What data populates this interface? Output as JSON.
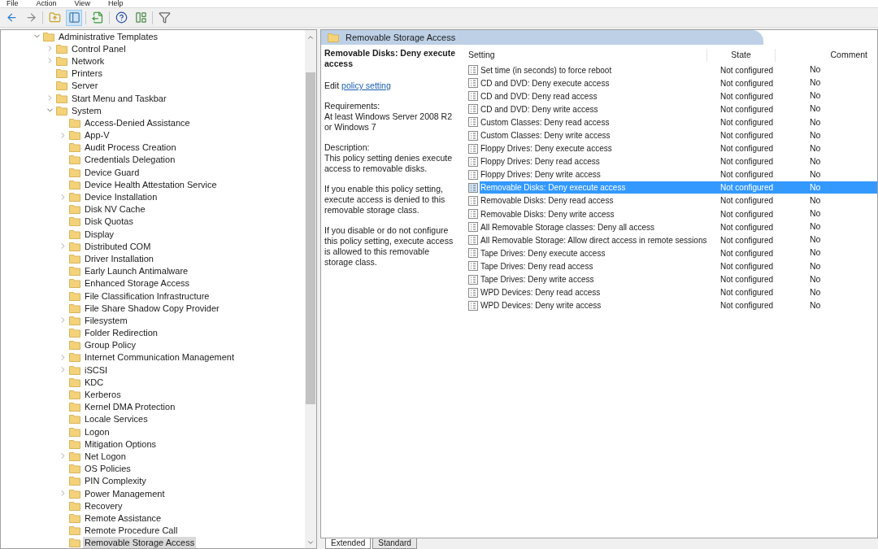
{
  "menu": [
    "File",
    "Action",
    "View",
    "Help"
  ],
  "toolbar": [
    {
      "kind": "back",
      "pressed": false
    },
    {
      "kind": "forward",
      "pressed": false
    },
    {
      "kind": "up",
      "pressed": false
    },
    {
      "kind": "tree",
      "pressed": true
    },
    {
      "kind": "export",
      "pressed": false
    },
    {
      "kind": "help",
      "pressed": false
    },
    {
      "kind": "properties",
      "pressed": false
    },
    {
      "kind": "filter",
      "pressed": false
    }
  ],
  "tree": [
    {
      "label": "Administrative Templates",
      "kind": "branch",
      "expanded": true,
      "selected": false,
      "children": [
        {
          "label": "Control Panel",
          "kind": "branch",
          "expanded": false,
          "selected": false
        },
        {
          "label": "Network",
          "kind": "branch",
          "expanded": false,
          "selected": false
        },
        {
          "label": "Printers",
          "kind": "leaf",
          "selected": false
        },
        {
          "label": "Server",
          "kind": "leaf",
          "selected": false
        },
        {
          "label": "Start Menu and Taskbar",
          "kind": "branch",
          "expanded": false,
          "selected": false
        },
        {
          "label": "System",
          "kind": "branch",
          "expanded": true,
          "selected": false,
          "children": [
            {
              "label": "Access-Denied Assistance",
              "kind": "leaf",
              "selected": false
            },
            {
              "label": "App-V",
              "kind": "branch",
              "expanded": false,
              "selected": false
            },
            {
              "label": "Audit Process Creation",
              "kind": "leaf",
              "selected": false
            },
            {
              "label": "Credentials Delegation",
              "kind": "leaf",
              "selected": false
            },
            {
              "label": "Device Guard",
              "kind": "leaf",
              "selected": false
            },
            {
              "label": "Device Health Attestation Service",
              "kind": "leaf",
              "selected": false
            },
            {
              "label": "Device Installation",
              "kind": "branch",
              "expanded": false,
              "selected": false
            },
            {
              "label": "Disk NV Cache",
              "kind": "leaf",
              "selected": false
            },
            {
              "label": "Disk Quotas",
              "kind": "leaf",
              "selected": false
            },
            {
              "label": "Display",
              "kind": "leaf",
              "selected": false
            },
            {
              "label": "Distributed COM",
              "kind": "branch",
              "expanded": false,
              "selected": false
            },
            {
              "label": "Driver Installation",
              "kind": "leaf",
              "selected": false
            },
            {
              "label": "Early Launch Antimalware",
              "kind": "leaf",
              "selected": false
            },
            {
              "label": "Enhanced Storage Access",
              "kind": "leaf",
              "selected": false
            },
            {
              "label": "File Classification Infrastructure",
              "kind": "leaf",
              "selected": false
            },
            {
              "label": "File Share Shadow Copy Provider",
              "kind": "leaf",
              "selected": false
            },
            {
              "label": "Filesystem",
              "kind": "branch",
              "expanded": false,
              "selected": false
            },
            {
              "label": "Folder Redirection",
              "kind": "leaf",
              "selected": false
            },
            {
              "label": "Group Policy",
              "kind": "leaf",
              "selected": false
            },
            {
              "label": "Internet Communication Management",
              "kind": "branch",
              "expanded": false,
              "selected": false
            },
            {
              "label": "iSCSI",
              "kind": "branch",
              "expanded": false,
              "selected": false
            },
            {
              "label": "KDC",
              "kind": "leaf",
              "selected": false
            },
            {
              "label": "Kerberos",
              "kind": "leaf",
              "selected": false
            },
            {
              "label": "Kernel DMA Protection",
              "kind": "leaf",
              "selected": false
            },
            {
              "label": "Locale Services",
              "kind": "leaf",
              "selected": false
            },
            {
              "label": "Logon",
              "kind": "leaf",
              "selected": false
            },
            {
              "label": "Mitigation Options",
              "kind": "leaf",
              "selected": false
            },
            {
              "label": "Net Logon",
              "kind": "branch",
              "expanded": false,
              "selected": false
            },
            {
              "label": "OS Policies",
              "kind": "leaf",
              "selected": false
            },
            {
              "label": "PIN Complexity",
              "kind": "leaf",
              "selected": false
            },
            {
              "label": "Power Management",
              "kind": "branch",
              "expanded": false,
              "selected": false
            },
            {
              "label": "Recovery",
              "kind": "leaf",
              "selected": false
            },
            {
              "label": "Remote Assistance",
              "kind": "leaf",
              "selected": false
            },
            {
              "label": "Remote Procedure Call",
              "kind": "leaf",
              "selected": false
            },
            {
              "label": "Removable Storage Access",
              "kind": "leaf",
              "selected": true
            }
          ]
        }
      ]
    }
  ],
  "header": {
    "title": "Removable Storage Access"
  },
  "details": {
    "title": "Removable Disks: Deny execute access",
    "edit_prefix": "Edit",
    "edit_link": "policy setting",
    "requirements_label": "Requirements:",
    "requirements": "At least Windows Server 2008 R2 or Windows 7",
    "description_label": "Description:",
    "paragraphs": [
      "This policy setting denies execute access to removable disks.",
      "If you enable this policy setting, execute access is denied to this removable storage class.",
      "If you disable or do not configure this policy setting, execute access is allowed to this removable storage class."
    ]
  },
  "table": {
    "columns": [
      "Setting",
      "State",
      "Comment"
    ],
    "rows": [
      {
        "setting": "Set time (in seconds) to force reboot",
        "state": "Not configured",
        "comment": "No",
        "selected": false
      },
      {
        "setting": "CD and DVD: Deny execute access",
        "state": "Not configured",
        "comment": "No",
        "selected": false
      },
      {
        "setting": "CD and DVD: Deny read access",
        "state": "Not configured",
        "comment": "No",
        "selected": false
      },
      {
        "setting": "CD and DVD: Deny write access",
        "state": "Not configured",
        "comment": "No",
        "selected": false
      },
      {
        "setting": "Custom Classes: Deny read access",
        "state": "Not configured",
        "comment": "No",
        "selected": false
      },
      {
        "setting": "Custom Classes: Deny write access",
        "state": "Not configured",
        "comment": "No",
        "selected": false
      },
      {
        "setting": "Floppy Drives: Deny execute access",
        "state": "Not configured",
        "comment": "No",
        "selected": false
      },
      {
        "setting": "Floppy Drives: Deny read access",
        "state": "Not configured",
        "comment": "No",
        "selected": false
      },
      {
        "setting": "Floppy Drives: Deny write access",
        "state": "Not configured",
        "comment": "No",
        "selected": false
      },
      {
        "setting": "Removable Disks: Deny execute access",
        "state": "Not configured",
        "comment": "No",
        "selected": true
      },
      {
        "setting": "Removable Disks: Deny read access",
        "state": "Not configured",
        "comment": "No",
        "selected": false
      },
      {
        "setting": "Removable Disks: Deny write access",
        "state": "Not configured",
        "comment": "No",
        "selected": false
      },
      {
        "setting": "All Removable Storage classes: Deny all access",
        "state": "Not configured",
        "comment": "No",
        "selected": false
      },
      {
        "setting": "All Removable Storage: Allow direct access in remote sessions",
        "state": "Not configured",
        "comment": "No",
        "selected": false
      },
      {
        "setting": "Tape Drives: Deny execute access",
        "state": "Not configured",
        "comment": "No",
        "selected": false
      },
      {
        "setting": "Tape Drives: Deny read access",
        "state": "Not configured",
        "comment": "No",
        "selected": false
      },
      {
        "setting": "Tape Drives: Deny write access",
        "state": "Not configured",
        "comment": "No",
        "selected": false
      },
      {
        "setting": "WPD Devices: Deny read access",
        "state": "Not configured",
        "comment": "No",
        "selected": false
      },
      {
        "setting": "WPD Devices: Deny write access",
        "state": "Not configured",
        "comment": "No",
        "selected": false
      }
    ]
  },
  "view_tabs": [
    {
      "label": "Extended",
      "selected": true
    },
    {
      "label": "Standard",
      "selected": false
    }
  ]
}
